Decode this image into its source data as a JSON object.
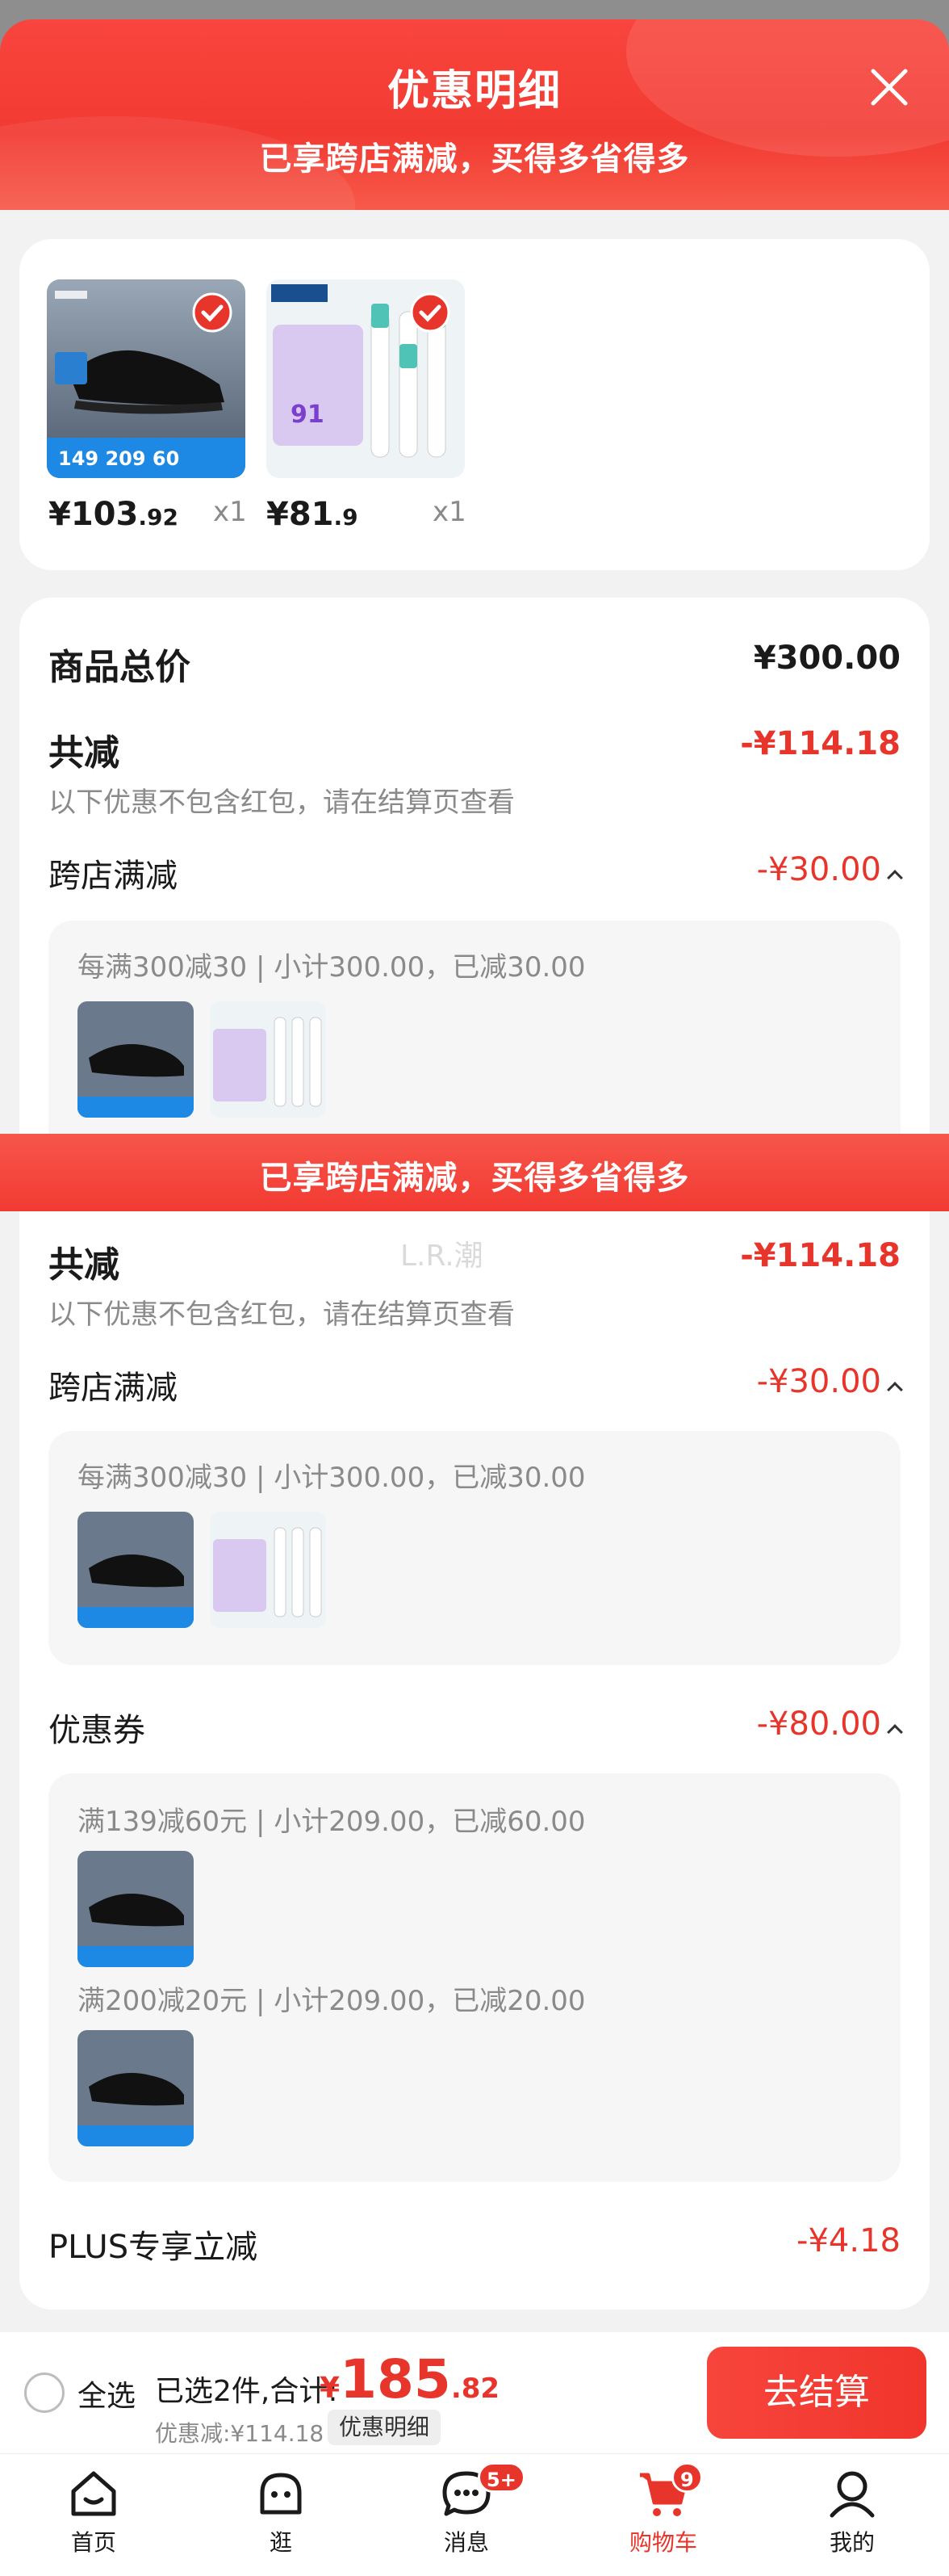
{
  "header": {
    "title": "优惠明细",
    "subtitle": "已享跨店满减，买得多省得多"
  },
  "products": [
    {
      "price_int": "¥103",
      "price_dec": ".92",
      "qty": "x1",
      "thumb_text": "149 209 60"
    },
    {
      "price_int": "¥81",
      "price_dec": ".9",
      "qty": "x1",
      "thumb_text": "91"
    }
  ],
  "summary": {
    "total_label": "商品总价",
    "total_value": "¥300.00",
    "reduce_label": "共减",
    "reduce_value": "-¥114.18",
    "reduce_hint": "以下优惠不包含红包，请在结算页查看"
  },
  "cross_store": {
    "label": "跨店满减",
    "value": "-¥30.00",
    "rule": "每满300减30 | 小计300.00，已减30.00"
  },
  "overlay": {
    "banner": "已享跨店满减，买得多省得多",
    "watermark": "L.R.潮"
  },
  "coupons": {
    "label": "优惠券",
    "value": "-¥80.00",
    "rule1": "满139减60元 | 小计209.00，已减60.00",
    "rule2": "满200减20元 | 小计209.00，已减20.00"
  },
  "plus": {
    "label": "PLUS专享立减",
    "value": "-¥4.18"
  },
  "checkout": {
    "select_all": "全选",
    "selected": "已选2件,合计:",
    "sym": "¥",
    "big": "185",
    "dec": ".82",
    "discount": "优惠减:¥114.18",
    "detail_chip": "优惠明细",
    "button": "去结算"
  },
  "nav": {
    "home": "首页",
    "browse": "逛",
    "messages": "消息",
    "messages_badge": "5+",
    "cart": "购物车",
    "cart_badge": "9",
    "mine": "我的"
  },
  "colors": {
    "accent": "#e8352b",
    "header": "#f23a32"
  }
}
